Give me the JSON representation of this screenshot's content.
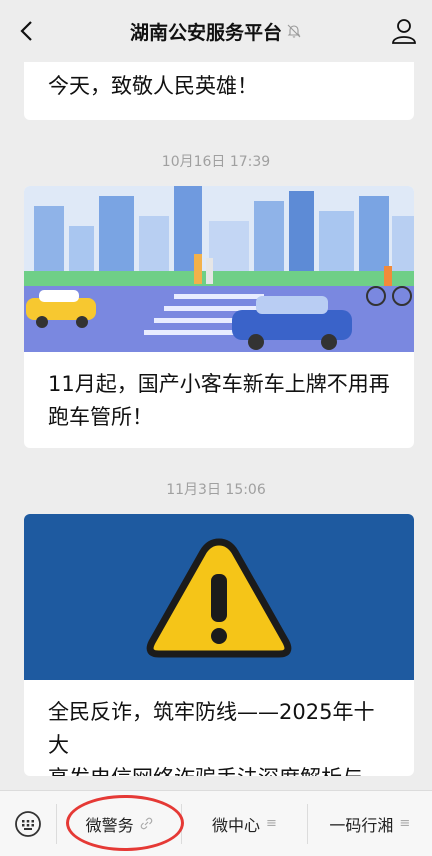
{
  "header": {
    "title": "湖南公安服务平台"
  },
  "messages": [
    {
      "text": "今天，致敬人民英雄！"
    },
    {
      "timestamp": "10月16日 17:39",
      "text_line1": "11月起，国产小客车新车上牌不用再",
      "text_line2": "跑车管所！"
    },
    {
      "timestamp": "11月3日 15:06",
      "text_line1": "全民反诈，筑牢防线——2025年十大",
      "text_line2": "高发电信网络诈骗手法深度解析与..."
    }
  ],
  "bottom_menu": {
    "items": [
      {
        "label": "微警务",
        "icon": "link-icon"
      },
      {
        "label": "微中心",
        "icon": "menu-lines-icon"
      },
      {
        "label": "一码行湘",
        "icon": "menu-lines-icon"
      }
    ]
  },
  "colors": {
    "background": "#ededed",
    "warning_bg": "#1e5aa0",
    "warning_yellow": "#f5c518",
    "annotation_red": "#e53935"
  }
}
